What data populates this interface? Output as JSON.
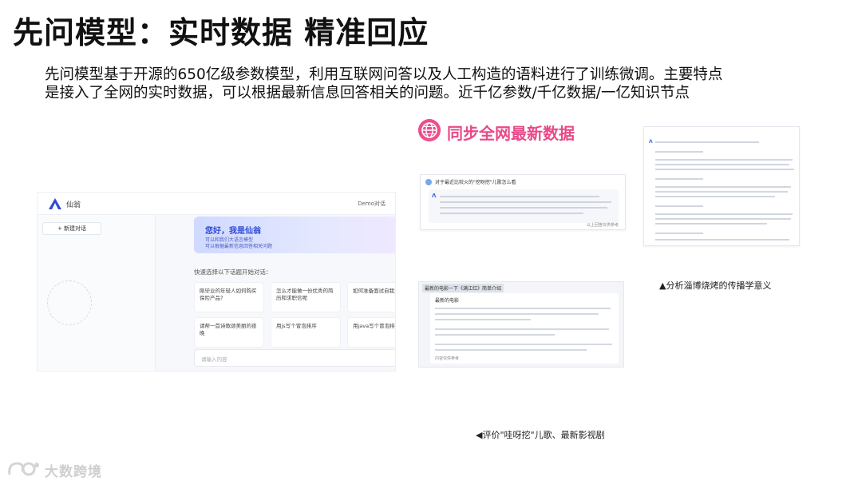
{
  "slide": {
    "title": "先问模型：实时数据  精准回应",
    "intro_line1": "先问模型基于开源的650亿级参数模型，利用互联网问答以及人工构造的语料进行了训练微调。主要特点",
    "intro_line2": "是接入了全网的实时数据，可以根据最新信息回答相关的问题。近千亿参数/千亿数据/一亿知识节点"
  },
  "app_screenshot": {
    "brand": "仙翁",
    "demo_link": "Demo对话",
    "new_chat_label": "+  新建对话",
    "greeting": "您好，我是仙翁",
    "greeting_sub1": "可以和我们大语言模型",
    "greeting_sub2": "可以根据最新信息回答相关问题",
    "section_label": "快速选择以下话题开始对话：",
    "cards": [
      "刚毕业的年轻人如何购买保险产品？",
      "怎么才能做一份优秀的简历和求职信呢",
      "如何准备面试自我介绍",
      "请帮一首诗歌颂美丽的夜晚",
      "用js写个冒泡排序",
      "用java写个冒泡排序"
    ],
    "input_placeholder": "请输入内容"
  },
  "banner": {
    "text": "同步全网最新数据",
    "icon": "globe-icon",
    "color": "#e84a88"
  },
  "chat_example_top": {
    "question": "对于最近比较火的\"挖呀挖\"儿歌怎么看",
    "answer_icon": "Λ",
    "footer": "以上回答仅供参考"
  },
  "chat_example_bottom": {
    "tag": "最新的电影一下《满江红》简单介绍",
    "question": "最新的电影",
    "footer": "内容仅供参考"
  },
  "captions": {
    "right": "▲分析淄博烧烤的传播学意义",
    "center": "◀评价\"哇呀挖\"儿歌、最新影视剧"
  },
  "watermark": {
    "text": "大数跨境"
  }
}
